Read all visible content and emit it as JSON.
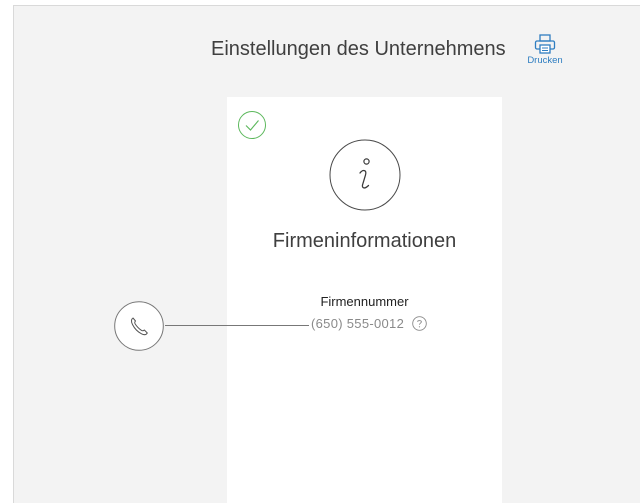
{
  "header": {
    "title": "Einstellungen des Unternehmens",
    "print_label": "Drucken"
  },
  "card": {
    "title": "Firmeninformationen",
    "status_icon": "check-circle-icon",
    "header_icon": "info-icon",
    "field": {
      "label": "Firmennummer",
      "value": "(650) 555-0012",
      "help_icon": "question-circle-icon",
      "side_icon": "phone-icon"
    }
  },
  "colors": {
    "accent_blue": "#2f7ec1",
    "check_green": "#5cb85c",
    "background": "#f3f3f3",
    "card": "#ffffff"
  }
}
